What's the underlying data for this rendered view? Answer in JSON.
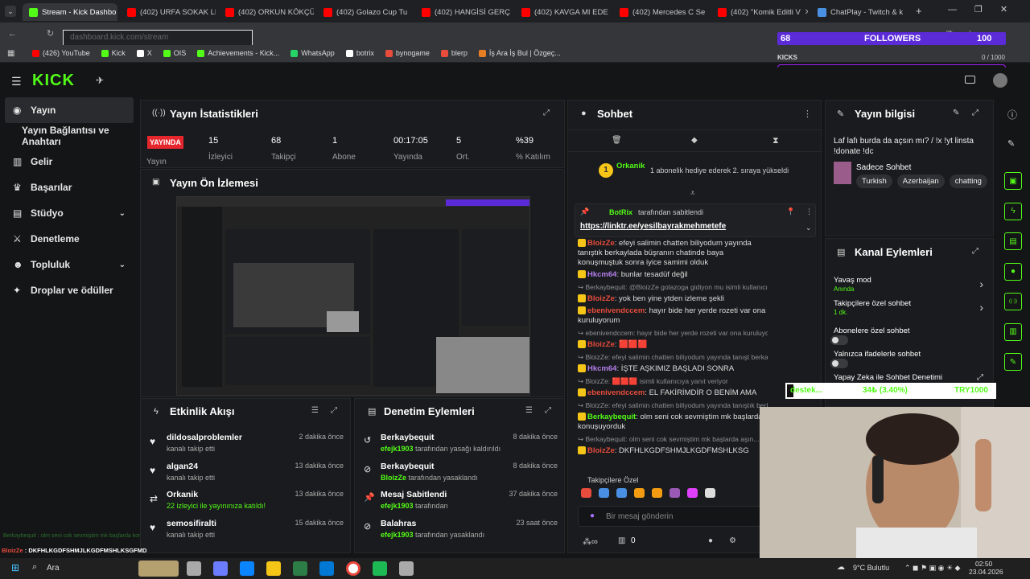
{
  "browser": {
    "tabs": [
      {
        "label": "Stream - Kick Dashbo",
        "color": "#53fc18",
        "active": true
      },
      {
        "label": "(402) URFA SOKAK LE",
        "color": "#ff0000"
      },
      {
        "label": "(402) ORKUN KÖKÇÜ",
        "color": "#ff0000"
      },
      {
        "label": "(402) Golazo Cup Tu",
        "color": "#ff0000"
      },
      {
        "label": "(402) HANGİSİ GERÇ",
        "color": "#ff0000"
      },
      {
        "label": "(402) KAVGA MI EDE",
        "color": "#ff0000"
      },
      {
        "label": "(402) Mercedes C Se",
        "color": "#ff0000"
      },
      {
        "label": "(402) \"Komik Editli V",
        "color": "#ff0000"
      },
      {
        "label": "ChatPlay - Twitch & k",
        "color": "#4a90e2"
      }
    ],
    "url": "dashboard.kick.com/stream",
    "bookmarks": [
      "(426) YouTube",
      "Kick",
      "X",
      "OIS",
      "Achievements - Kick...",
      "WhatsApp",
      "botrix",
      "bynogame",
      "blerp",
      "İş Ara İş Bul | Özgeç..."
    ]
  },
  "overlay": {
    "followers_count": "68",
    "followers_label": "FOLLOWERS",
    "followers_goal": "100",
    "kicks_label": "KICKS",
    "kicks_value": "0 / 1000",
    "donate_name": "destek...",
    "donate_amount": "34₺ (3.40%)",
    "donate_goal": "TRY1000"
  },
  "sidebar": {
    "items": [
      {
        "label": "Yayın",
        "active": true
      },
      {
        "label": "Yayın Bağlantısı ve Anahtarı"
      },
      {
        "label": "Gelir"
      },
      {
        "label": "Başarılar"
      },
      {
        "label": "Stüdyo"
      },
      {
        "label": "Denetleme"
      },
      {
        "label": "Topluluk"
      },
      {
        "label": "Droplar ve ödüller"
      }
    ]
  },
  "stats": {
    "title": "Yayın İstatistikleri",
    "live_badge": "YAYINDA",
    "live_label": "Yayın",
    "items": [
      {
        "value": "15",
        "label": "İzleyici"
      },
      {
        "value": "68",
        "label": "Takipçi"
      },
      {
        "value": "1",
        "label": "Abone"
      },
      {
        "value": "00:17:05",
        "label": "Yayında"
      },
      {
        "value": "5",
        "label": "Ort."
      },
      {
        "value": "%39",
        "label": "% Katılım"
      }
    ]
  },
  "preview": {
    "title": "Yayın Ön İzlemesi"
  },
  "activity": {
    "title": "Etkinlik Akışı",
    "rows": [
      {
        "name": "dildosalproblemler",
        "sub": "kanalı takip etti",
        "time": "2 dakika önce"
      },
      {
        "name": "algan24",
        "sub": "kanalı takip etti",
        "time": "13 dakika önce"
      },
      {
        "name": "Orkanik",
        "sub": "22 izleyici ile yayınınıza katıldı!",
        "time": "13 dakika önce"
      },
      {
        "name": "semosifiralti",
        "sub": "kanalı takip etti",
        "time": "15 dakika önce"
      }
    ]
  },
  "moderation": {
    "title": "Denetim Eylemleri",
    "rows": [
      {
        "name": "Berkaybequit",
        "sub_user": "efejk1903",
        "sub": " tarafından yasağı kaldırıldı",
        "time": "8 dakika önce"
      },
      {
        "name": "Berkaybequit",
        "sub_user": "BloizZe",
        "sub": " tarafından yasaklandı",
        "time": "8 dakika önce"
      },
      {
        "name": "Mesaj Sabitlendi",
        "sub_user": "efejk1903",
        "sub": " tarafından",
        "time": "37 dakika önce"
      },
      {
        "name": "Balahras",
        "sub_user": "efejk1903",
        "sub": " tarafından yasaklandı",
        "time": "23 saat önce"
      }
    ]
  },
  "chat": {
    "title": "Sohbet",
    "gift_user": "Orkanik",
    "gift_text": "1 abonelik hediye ederek 2. sıraya yükseldi",
    "pinned_by": "BotRix",
    "pinned_suffix": " tarafından sabitlendi",
    "pinned_link": "https://linktr.ee/yesilbayrakmehmetefe",
    "messages": [
      {
        "user": "BloizZe",
        "color": "#e74c3c",
        "text": ": efeyi salimin chatten biliyodum yayında tanıştık berkaylada büşranın chatinde baya konuşmuştuk sonra iyice samimi olduk"
      },
      {
        "user": "Hkcm64",
        "color": "#b37feb",
        "text": ": bunlar tesadüf değil"
      },
      {
        "reply": "Berkaybequit: @BloizZe golazoga gidiyon mu isimli kullanıcıya yanıt v..."
      },
      {
        "user": "BloizZe",
        "color": "#e74c3c",
        "text": ": yok ben yine ytden izleme şekli"
      },
      {
        "user": "ebenivendccem",
        "color": "#e74c3c",
        "text": ": hayır bide her yerde rozeti var ona kuruluyorum"
      },
      {
        "reply": "ebenivendccem: hayır bide her yerde rozeti var ona kuruluyorum isimli..."
      },
      {
        "user": "BloizZe",
        "color": "#e74c3c",
        "text": ": 🟥🟥🟥"
      },
      {
        "reply": "BloizZe: efeyi salimin chatten biliyodum yayında tanışt berkaylada bi..."
      },
      {
        "user": "Hkcm64",
        "color": "#b37feb",
        "text": ": İŞTE AŞKIMIZ BAŞLADI SONRA"
      },
      {
        "reply": "BloizZe: 🟥🟥🟥 isimli kullanıcıya yanıt veriyor"
      },
      {
        "user": "ebenivendccem",
        "color": "#e74c3c",
        "text": ": EL FAKİRİMDİR O BENİM AMA"
      },
      {
        "reply": "BloizZe: efeyi salimin chatten biliyodum yayında tanıştık berkaylada bi..."
      },
      {
        "user": "Berkaybequit",
        "color": "#53fc18",
        "text": ": olm seni cok sevmiştim mk başlarda konuşuyorduk"
      },
      {
        "reply": "Berkaybequit: olm seni cok sevmiştim mk başlarda aşın..."
      },
      {
        "user": "BloizZe",
        "color": "#e74c3c",
        "text": ": DKFHLKGDFSHMJLKGDFMSHLKSG"
      }
    ],
    "mode_label": "Takipçilere Özel",
    "input_placeholder": "Bir mesaj gönderin",
    "bottom_count": "0"
  },
  "info": {
    "title": "Yayın bilgisi",
    "stream_title": "Laf lafı burda da açsın mı? / !x !yt linsta !donate !dc",
    "category": "Sadece Sohbet",
    "tags": [
      "Turkish",
      "Azerbaijan",
      "chatting"
    ]
  },
  "channel_actions": {
    "title": "Kanal Eylemleri",
    "items": [
      {
        "label": "Yavaş mod",
        "sub": "Anında",
        "control": "arrow"
      },
      {
        "label": "Takipçilere özel sohbet",
        "sub": "1 dk.",
        "control": "arrow"
      },
      {
        "label": "Abonelere özel sohbet",
        "control": "toggle"
      },
      {
        "label": "Yalnızca ifadelerle sohbet",
        "control": "toggle"
      },
      {
        "label": "Yapay Zeka ile Sohbet Denetimi",
        "control": "link"
      }
    ]
  },
  "ticker": {
    "line1": "Berkaybequit : olm seni cok sevmiştim mk başlarda konuşuyorduk",
    "line2_user": "BloizZe",
    "line2_text": " : DKFHLKGDFSHMJLKGDFMSHLKSGFMD"
  },
  "taskbar": {
    "search": "Ara",
    "weather": "9°C Bulutlu",
    "time": "02:50",
    "date": "23.04.2026"
  }
}
